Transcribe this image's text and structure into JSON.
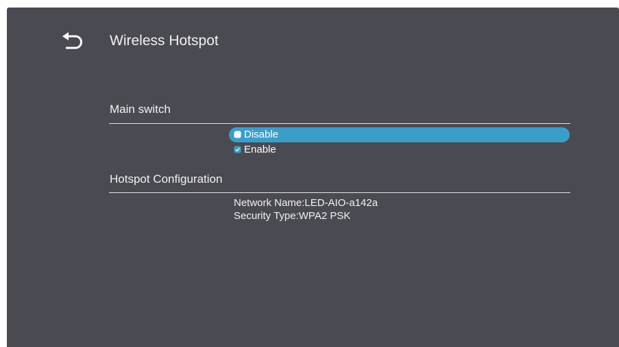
{
  "header": {
    "back_icon": "back-arrow-icon",
    "title": "Wireless Hotspot"
  },
  "main_switch": {
    "heading": "Main switch",
    "options": [
      {
        "label": "Disable",
        "icon": "selected-square-icon",
        "selected": true
      },
      {
        "label": "Enable",
        "icon": "checkbox-checked-icon",
        "selected": false
      }
    ]
  },
  "hotspot_config": {
    "heading": "Hotspot Configuration",
    "network_name": "Network Name:LED-AIO-a142a",
    "security_type": "Security Type:WPA2 PSK"
  },
  "colors": {
    "background": "#4a4a52",
    "highlight": "#3a9ec9",
    "text": "#ffffff"
  }
}
